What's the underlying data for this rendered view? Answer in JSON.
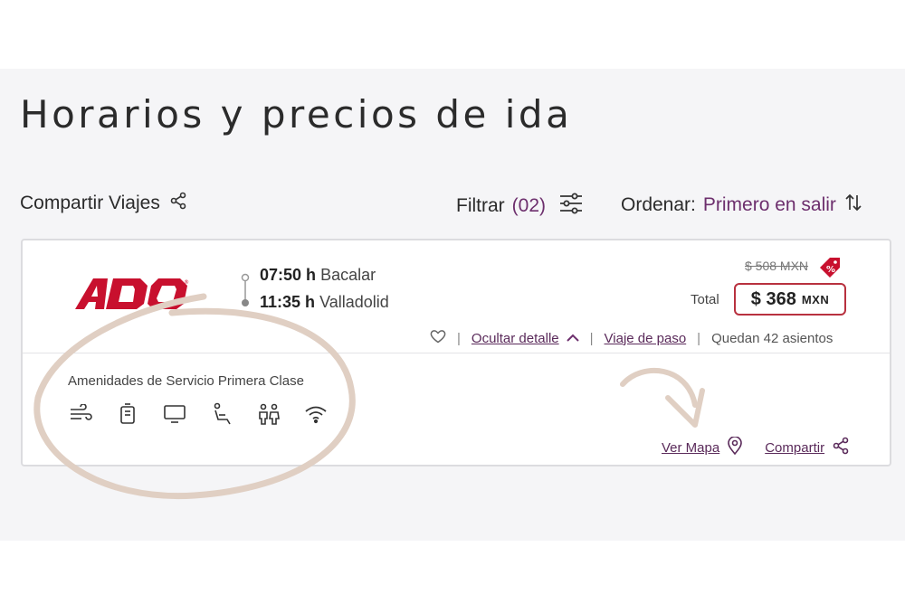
{
  "page": {
    "title": "Horarios y precios de ida"
  },
  "toolbar": {
    "share_label": "Compartir Viajes",
    "filter_label": "Filtrar",
    "filter_count": "(02)",
    "sort_label": "Ordenar:",
    "sort_value": "Primero en salir"
  },
  "trip": {
    "carrier_logo": "ADO",
    "departure_time": "07:50 h",
    "departure_city": "Bacalar",
    "arrival_time": "11:35 h",
    "arrival_city": "Valladolid",
    "old_price": "$ 508 MXN",
    "total_label": "Total",
    "price_amount": "$ 368",
    "price_currency": "MXN",
    "hide_detail_label": "Ocultar detalle",
    "transit_label": "Viaje de paso",
    "seats_left": "Quedan 42 asientos",
    "amenities_title": "Amenidades de Servicio Primera Clase",
    "amenities": [
      "air-conditioning-icon",
      "restroom-icon",
      "tv-icon",
      "reclining-seat-icon",
      "restrooms-icon",
      "wifi-icon"
    ],
    "map_label": "Ver Mapa",
    "share_label": "Compartir"
  },
  "colors": {
    "accent_purple": "#6d2f6d",
    "price_border": "#b8313f",
    "brand_red": "#c8102e",
    "annotation": "#e0cfc3"
  }
}
